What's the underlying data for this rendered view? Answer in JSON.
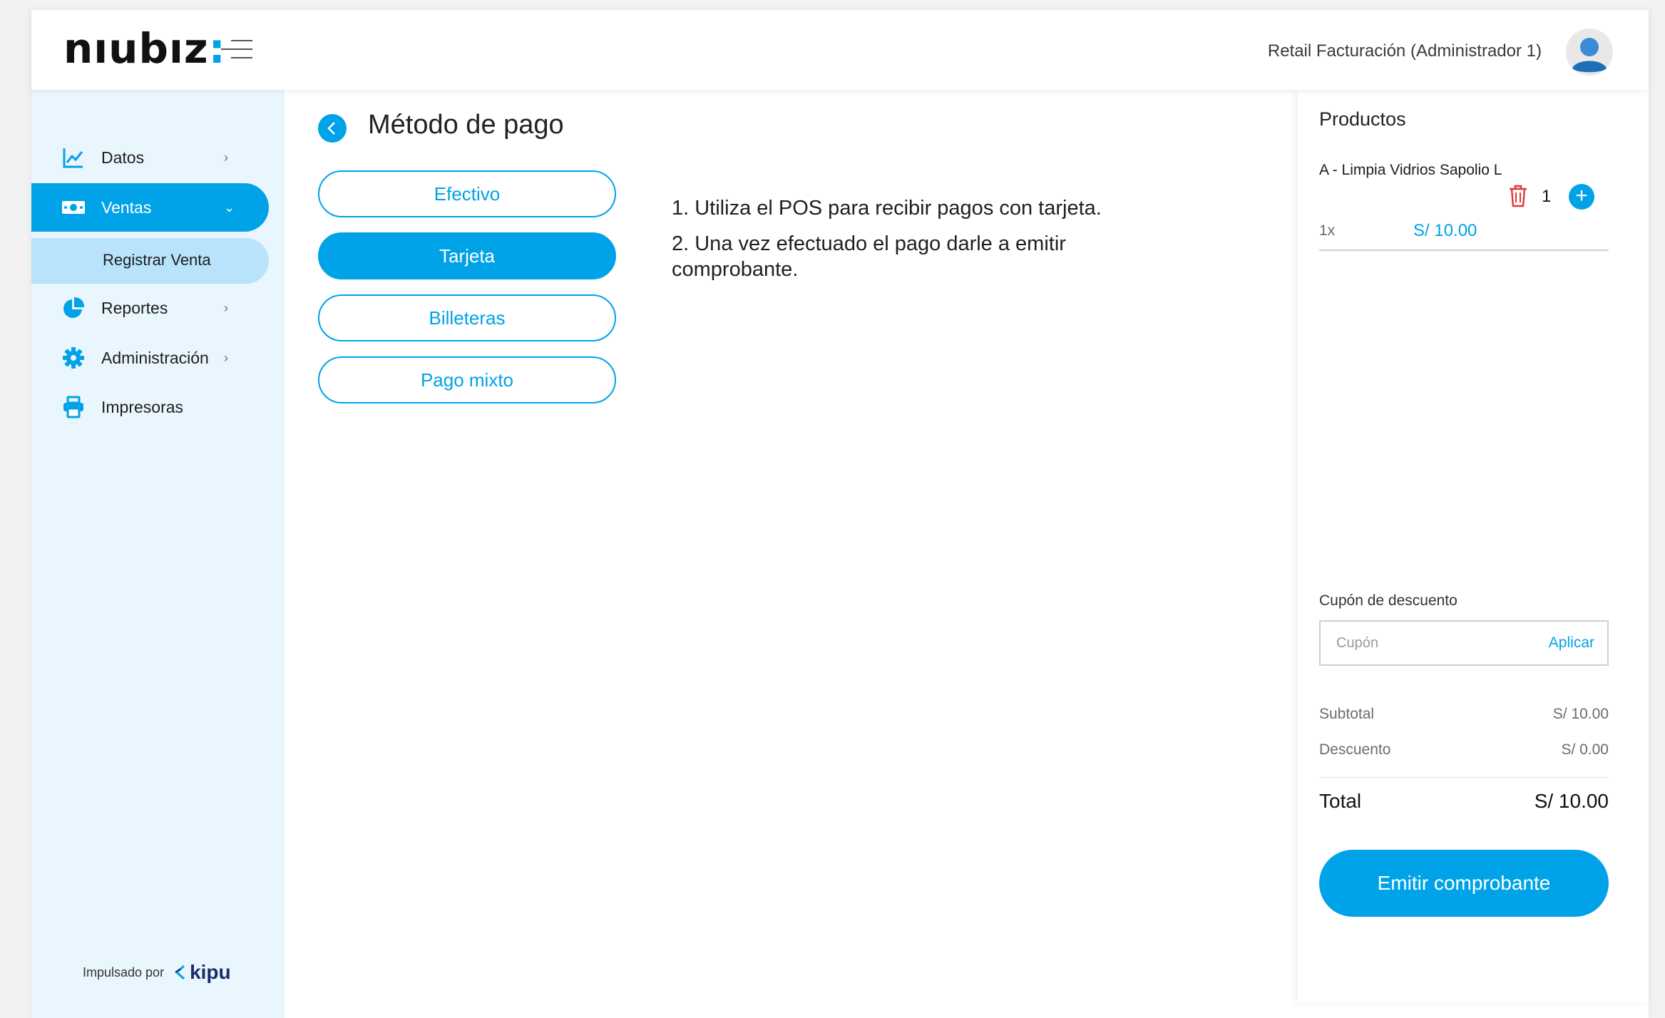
{
  "header": {
    "logo_text": "nıubız",
    "logo_colon": ":",
    "user_name": "Retail Facturación (Administrador 1)"
  },
  "sidebar": {
    "items": [
      {
        "label": "Datos",
        "icon": "line-chart-icon",
        "chevron": "›"
      },
      {
        "label": "Ventas",
        "icon": "cash-icon",
        "chevron": "⌄"
      },
      {
        "label": "Reportes",
        "icon": "pie-chart-icon",
        "chevron": "›"
      },
      {
        "label": "Administración",
        "icon": "gear-icon",
        "chevron": "›"
      },
      {
        "label": "Impresoras",
        "icon": "printer-icon"
      }
    ],
    "subitem": {
      "label": "Registrar Venta"
    },
    "powered_by": {
      "label": "Impulsado por",
      "brand": "kipu"
    }
  },
  "main": {
    "title": "Método de pago",
    "payment_methods": [
      {
        "label": "Efectivo",
        "selected": false
      },
      {
        "label": "Tarjeta",
        "selected": true
      },
      {
        "label": "Billeteras",
        "selected": false
      },
      {
        "label": "Pago mixto",
        "selected": false
      }
    ],
    "instructions": [
      "1. Utiliza el POS para recibir pagos con tarjeta.",
      "2. Una vez efectuado el pago darle a emitir comprobante."
    ]
  },
  "panel": {
    "title": "Productos",
    "product": {
      "name": "A - Limpia Vidrios Sapolio L",
      "quantity": "1",
      "multiplier": "1x",
      "price": "S/ 10.00"
    },
    "coupon": {
      "label": "Cupón de descuento",
      "placeholder": "Cupón",
      "apply_label": "Aplicar"
    },
    "subtotal": {
      "label": "Subtotal",
      "value": "S/ 10.00"
    },
    "discount": {
      "label": "Descuento",
      "value": "S/ 0.00"
    },
    "total": {
      "label": "Total",
      "value": "S/ 10.00"
    },
    "emit_label": "Emitir comprobante"
  },
  "colors": {
    "accent": "#00a2e8",
    "sidebar_bg": "#eaf6fd",
    "subitem_bg": "#b8e3fa",
    "delete": "#e53935"
  }
}
